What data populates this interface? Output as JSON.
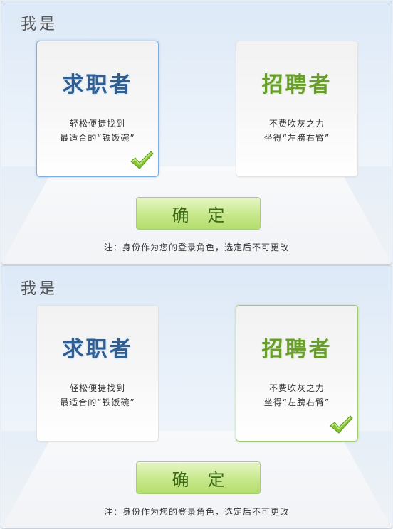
{
  "panels": [
    {
      "title": "我是",
      "seeker": {
        "name": "求职者",
        "desc_line1": "轻松便捷找到",
        "desc_line2": "最适合的“铁饭碗”",
        "selected": true
      },
      "recruiter": {
        "name": "招聘者",
        "desc_line1": "不费吹灰之力",
        "desc_line2": "坐得“左膀右臂”",
        "selected": false
      },
      "confirm_label": "确定",
      "note": "注：身份作为您的登录角色，选定后不可更改"
    },
    {
      "title": "我是",
      "seeker": {
        "name": "求职者",
        "desc_line1": "轻松便捷找到",
        "desc_line2": "最适合的“铁饭碗”",
        "selected": false
      },
      "recruiter": {
        "name": "招聘者",
        "desc_line1": "不费吹灰之力",
        "desc_line2": "坐得“左膀右臂”",
        "selected": true
      },
      "confirm_label": "确定",
      "note": "注：身份作为您的登录角色，选定后不可更改"
    }
  ],
  "icons": {
    "check": "green-checkmark-icon"
  },
  "colors": {
    "seeker_text": "#2f5f92",
    "recruiter_text": "#6a9e2c",
    "button_green": "#c9e98f",
    "check_green": "#7ab829"
  }
}
